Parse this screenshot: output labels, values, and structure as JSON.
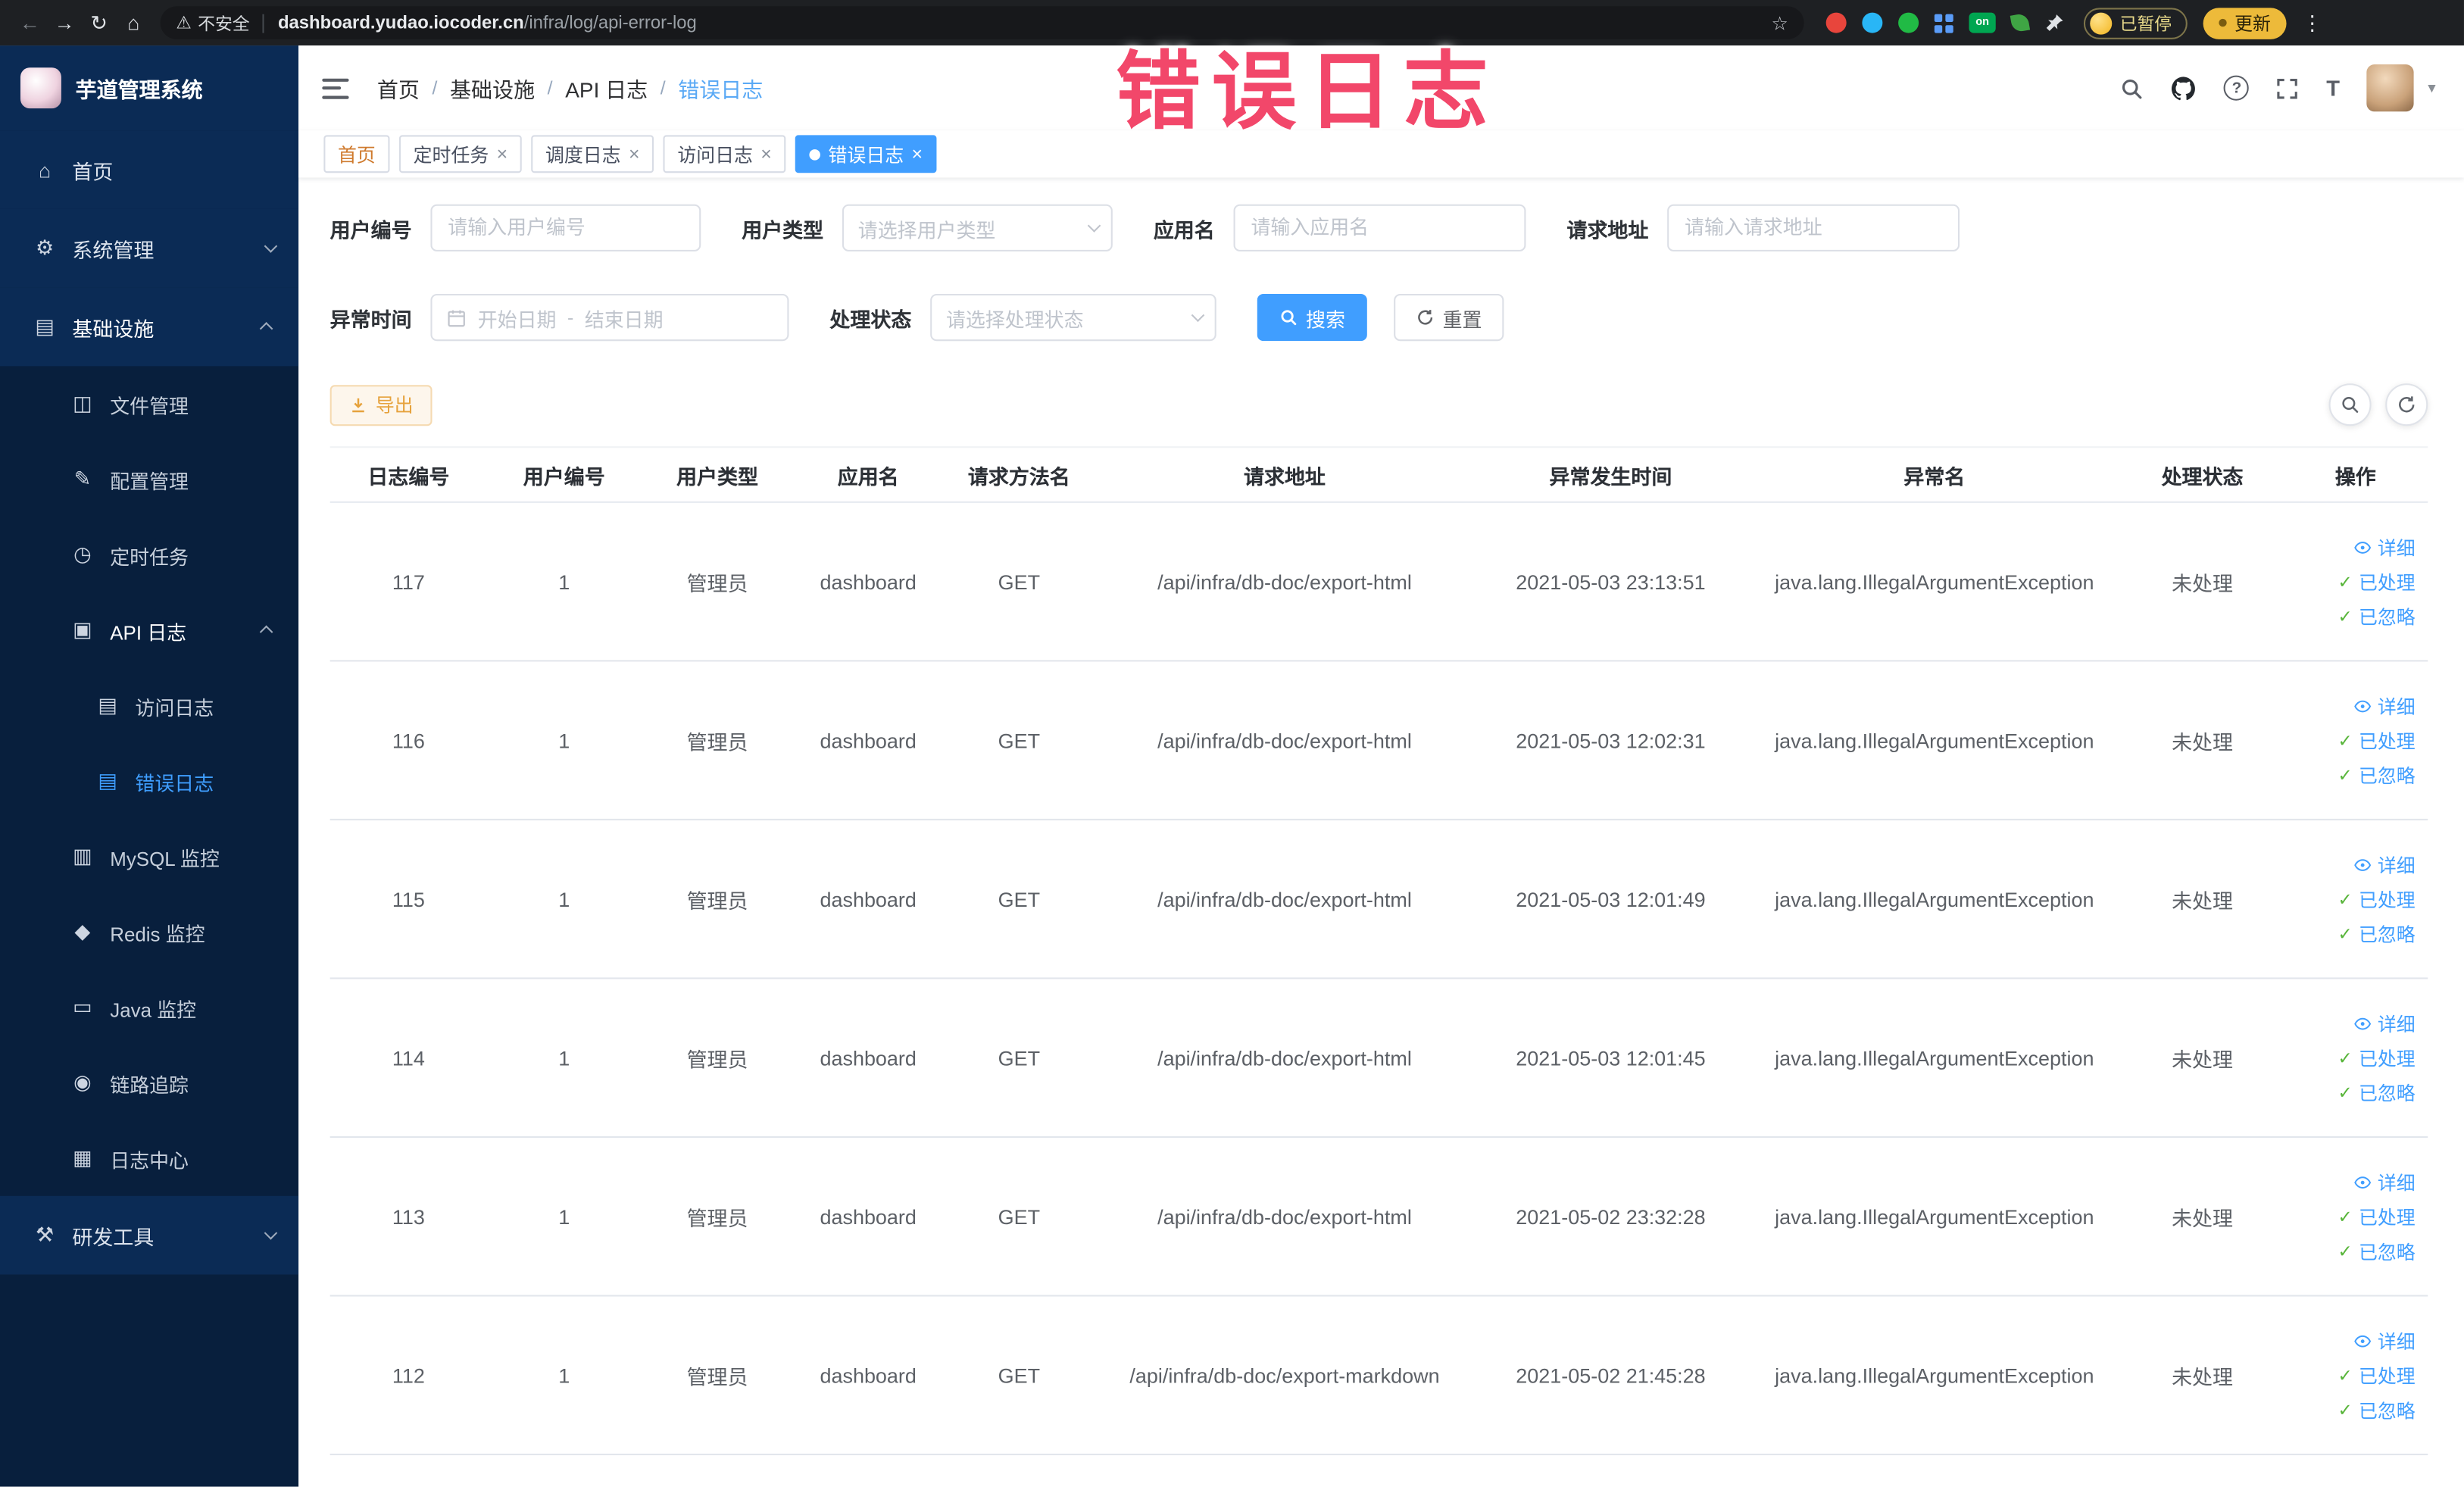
{
  "annotation": {
    "text": "错误日志"
  },
  "icons": {
    "back": "←",
    "forward": "→",
    "reload": "↻",
    "home": "⌂",
    "warning": "⚠",
    "star": "☆",
    "menu_dots": "⋮",
    "question": "?",
    "close": "×",
    "check": "✓",
    "font_size": "T",
    "caret": "▾",
    "url_separator": "|"
  },
  "browser": {
    "security_label": "不安全",
    "url_domain": "dashboard.yudao.iocoder.cn",
    "url_path": "/infra/log/api-error-log",
    "extension_on_label": "on",
    "paused_badge": "已暂停",
    "update_button": "更新"
  },
  "sidebar": {
    "logo_title": "芋道管理系统",
    "items": [
      {
        "label": "首页",
        "icon": "⌂"
      },
      {
        "label": "系统管理",
        "icon": "⚙"
      },
      {
        "label": "基础设施",
        "icon": "▤"
      },
      {
        "label": "文件管理",
        "icon": "◫"
      },
      {
        "label": "配置管理",
        "icon": "✎"
      },
      {
        "label": "定时任务",
        "icon": "◷"
      },
      {
        "label": "API 日志",
        "icon": "▣"
      },
      {
        "label": "访问日志",
        "icon": "▤"
      },
      {
        "label": "错误日志",
        "icon": "▤"
      },
      {
        "label": "MySQL 监控",
        "icon": "▥"
      },
      {
        "label": "Redis 监控",
        "icon": "◆"
      },
      {
        "label": "Java 监控",
        "icon": "▭"
      },
      {
        "label": "链路追踪",
        "icon": "◉"
      },
      {
        "label": "日志中心",
        "icon": "▦"
      },
      {
        "label": "研发工具",
        "icon": "⚒"
      }
    ]
  },
  "breadcrumb": {
    "separator": "/",
    "items": [
      "首页",
      "基础设施",
      "API 日志",
      "错误日志"
    ]
  },
  "tabs": [
    {
      "label": "首页",
      "closable": false,
      "active": false
    },
    {
      "label": "定时任务",
      "closable": true,
      "active": false
    },
    {
      "label": "调度日志",
      "closable": true,
      "active": false
    },
    {
      "label": "访问日志",
      "closable": true,
      "active": false
    },
    {
      "label": "错误日志",
      "closable": true,
      "active": true
    }
  ],
  "filters": {
    "user_id_label": "用户编号",
    "user_id_placeholder": "请输入用户编号",
    "user_type_label": "用户类型",
    "user_type_placeholder": "请选择用户类型",
    "app_name_label": "应用名",
    "app_name_placeholder": "请输入应用名",
    "request_url_label": "请求地址",
    "request_url_placeholder": "请输入请求地址",
    "exception_time_label": "异常时间",
    "date_start_placeholder": "开始日期",
    "date_separator": "-",
    "date_end_placeholder": "结束日期",
    "process_status_label": "处理状态",
    "process_status_placeholder": "请选择处理状态",
    "search_button": "搜索",
    "reset_button": "重置"
  },
  "toolbar": {
    "export_button": "导出"
  },
  "table": {
    "columns": [
      "日志编号",
      "用户编号",
      "用户类型",
      "应用名",
      "请求方法名",
      "请求地址",
      "异常发生时间",
      "异常名",
      "处理状态",
      "操作"
    ],
    "actions": {
      "detail": "详细",
      "processed": "已处理",
      "ignored": "已忽略"
    },
    "rows": [
      {
        "id": "117",
        "user_id": "1",
        "user_type": "管理员",
        "app": "dashboard",
        "method": "GET",
        "url": "/api/infra/db-doc/export-html",
        "time": "2021-05-03 23:13:51",
        "exception": "java.lang.IllegalArgumentException",
        "status": "未处理"
      },
      {
        "id": "116",
        "user_id": "1",
        "user_type": "管理员",
        "app": "dashboard",
        "method": "GET",
        "url": "/api/infra/db-doc/export-html",
        "time": "2021-05-03 12:02:31",
        "exception": "java.lang.IllegalArgumentException",
        "status": "未处理"
      },
      {
        "id": "115",
        "user_id": "1",
        "user_type": "管理员",
        "app": "dashboard",
        "method": "GET",
        "url": "/api/infra/db-doc/export-html",
        "time": "2021-05-03 12:01:49",
        "exception": "java.lang.IllegalArgumentException",
        "status": "未处理"
      },
      {
        "id": "114",
        "user_id": "1",
        "user_type": "管理员",
        "app": "dashboard",
        "method": "GET",
        "url": "/api/infra/db-doc/export-html",
        "time": "2021-05-03 12:01:45",
        "exception": "java.lang.IllegalArgumentException",
        "status": "未处理"
      },
      {
        "id": "113",
        "user_id": "1",
        "user_type": "管理员",
        "app": "dashboard",
        "method": "GET",
        "url": "/api/infra/db-doc/export-html",
        "time": "2021-05-02 23:32:28",
        "exception": "java.lang.IllegalArgumentException",
        "status": "未处理"
      },
      {
        "id": "112",
        "user_id": "1",
        "user_type": "管理员",
        "app": "dashboard",
        "method": "GET",
        "url": "/api/infra/db-doc/export-markdown",
        "time": "2021-05-02 21:45:28",
        "exception": "java.lang.IllegalArgumentException",
        "status": "未处理"
      }
    ]
  },
  "colors": {
    "primary": "#409eff",
    "export_accent": "#e6a23c",
    "annotation": "#f2476a",
    "sidebar_bg": "#0b2b55"
  }
}
